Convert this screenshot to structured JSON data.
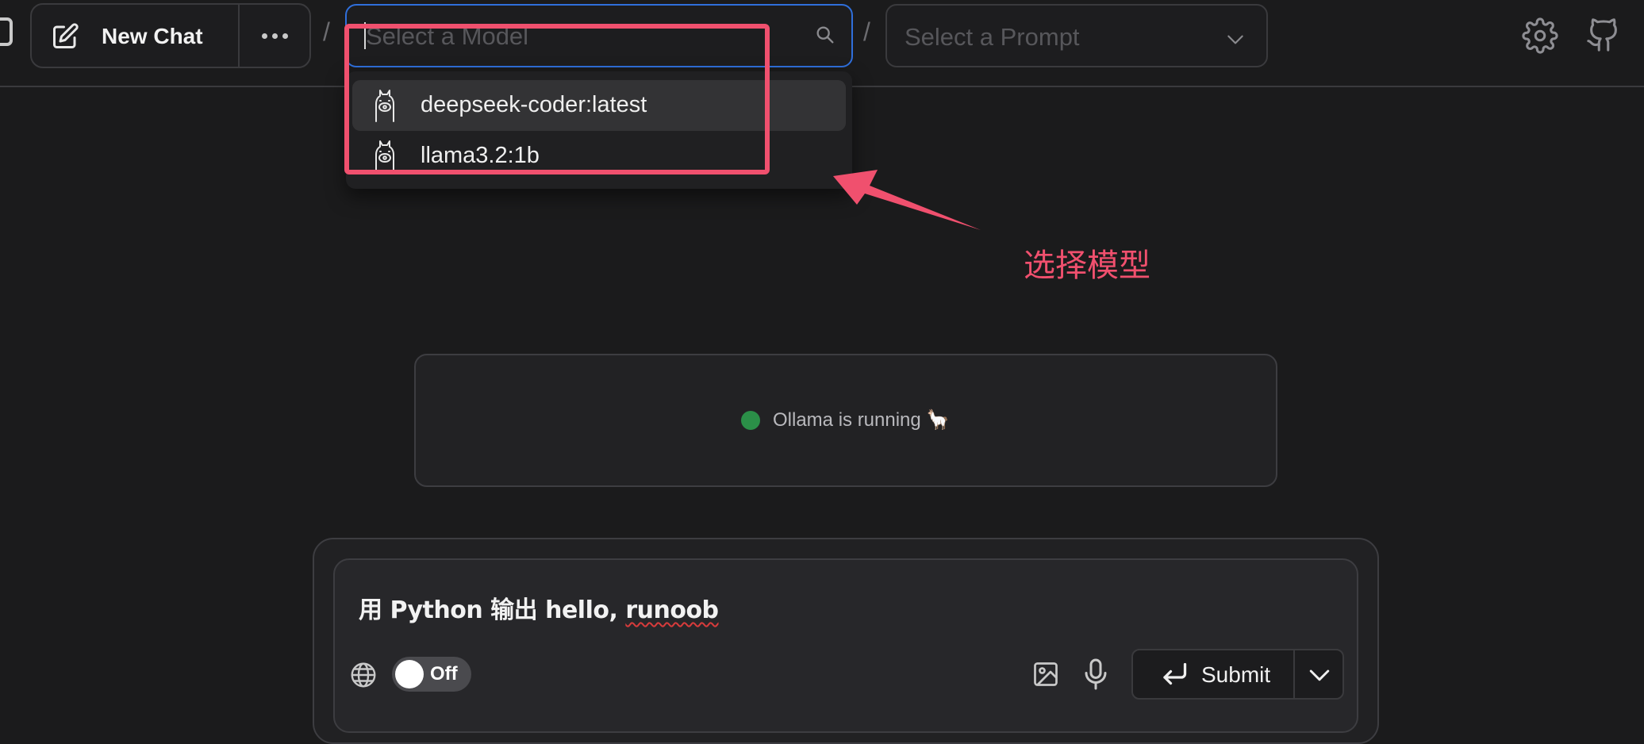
{
  "header": {
    "new_chat_label": "New Chat",
    "separator": "/",
    "model_search": {
      "placeholder": "Select a Model",
      "value": ""
    },
    "prompt_select": {
      "placeholder": "Select a Prompt"
    }
  },
  "model_dropdown": {
    "items": [
      {
        "label": "deepseek-coder:latest",
        "icon": "llama-icon",
        "highlighted": true
      },
      {
        "label": "llama3.2:1b",
        "icon": "llama-icon",
        "highlighted": false
      }
    ]
  },
  "annotation": {
    "label": "选择模型",
    "color": "#f0506e"
  },
  "status": {
    "text": "Ollama is running 🦙",
    "dot_color": "#2b8f48"
  },
  "composer": {
    "text_prefix": "用 Python 输出 hello, ",
    "text_misspelled": "runoob",
    "web_search_toggle": {
      "label": "Off",
      "state": "off"
    },
    "submit_label": "Submit"
  },
  "colors": {
    "background": "#1b1b1c",
    "focus_border": "#2f6fdb"
  }
}
